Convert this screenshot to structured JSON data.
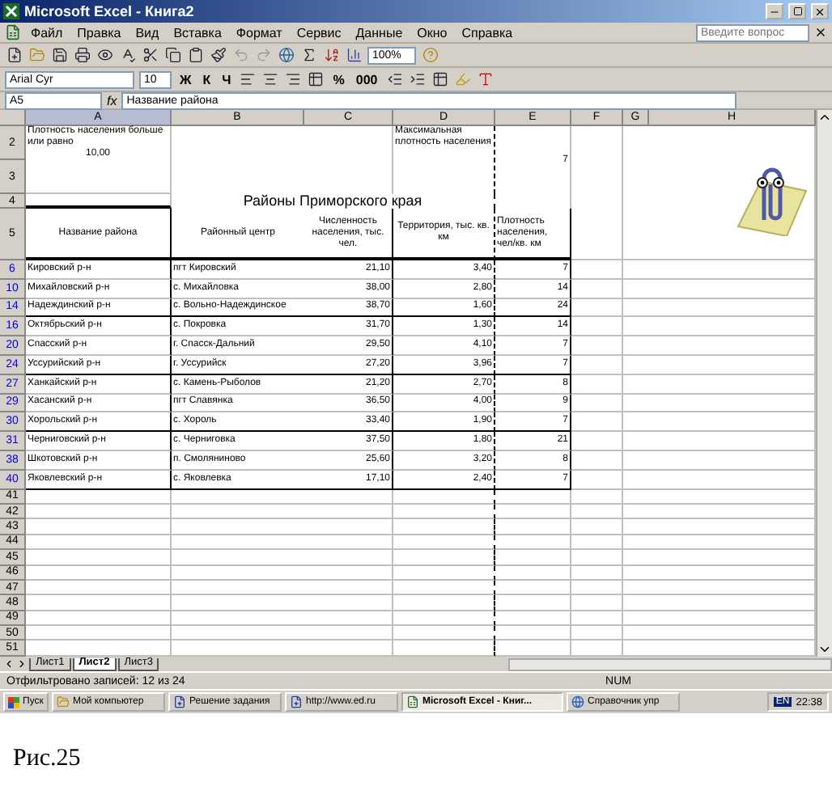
{
  "window": {
    "title": "Microsoft Excel - Книга2"
  },
  "menu": [
    "Файл",
    "Правка",
    "Вид",
    "Вставка",
    "Формат",
    "Сервис",
    "Данные",
    "Окно",
    "Справка"
  ],
  "help": {
    "placeholder": "Введите вопрос"
  },
  "standard_toolbar": {
    "zoom": "100%"
  },
  "format_toolbar": {
    "font": "Arial Cyr",
    "size": "10",
    "text_buttons": [
      {
        "label": "Ж",
        "selected": false
      },
      {
        "label": "К",
        "selected": false
      },
      {
        "label": "Ч",
        "selected": false
      }
    ],
    "number_buttons": [
      "%",
      "000"
    ]
  },
  "formula_bar": {
    "name_box": "A5",
    "fx_label": "fx",
    "formula": "Название района"
  },
  "columns": [
    {
      "label": "A",
      "selected": true
    },
    {
      "label": "B",
      "selected": false
    },
    {
      "label": "C",
      "selected": false
    },
    {
      "label": "D",
      "selected": false
    },
    {
      "label": "E",
      "selected": false
    },
    {
      "label": "F",
      "selected": false
    },
    {
      "label": "G",
      "selected": false
    },
    {
      "label": "H",
      "selected": false
    }
  ],
  "top_rows": {
    "row_labels": [
      "2",
      "3"
    ],
    "condition": "Плотность населения больше или равно",
    "threshold": "10,00",
    "max_label": "Максимальная плотность населения",
    "max_value": "7"
  },
  "title_row": {
    "row_label": "4",
    "title": "Районы Приморского края"
  },
  "header_row": {
    "row_label": "5",
    "cells": [
      "Название района",
      "Районный центр",
      "Численность населения, тыс. чел.",
      "Территория, тыс. кв. км",
      "Плотность населения, чел/кв. км"
    ]
  },
  "data_rows": [
    {
      "row_label": "6",
      "filtered": true,
      "cells": [
        "Кировский р-н",
        "пгт Кировский",
        "21,10",
        "3,40",
        "7"
      ]
    },
    {
      "row_label": "10",
      "filtered": true,
      "cells": [
        "Михайловский р-н",
        "с. Михайловка",
        "38,00",
        "2,80",
        "14"
      ]
    },
    {
      "row_label": "14",
      "filtered": true,
      "cells": [
        "Надеждинский р-н",
        "с. Вольно-Надеждинское",
        "38,70",
        "1,60",
        "24"
      ]
    },
    {
      "row_label": "16",
      "filtered": true,
      "cells": [
        "Октябрьский р-н",
        "с. Покровка",
        "31,70",
        "1,30",
        "14"
      ]
    },
    {
      "row_label": "20",
      "filtered": true,
      "cells": [
        "Спасский р-н",
        "г. Спасск-Дальний",
        "29,50",
        "4,10",
        "7"
      ]
    },
    {
      "row_label": "24",
      "filtered": true,
      "cells": [
        "Уссурийский р-н",
        "г. Уссурийск",
        "27,20",
        "3,96",
        "7"
      ]
    },
    {
      "row_label": "27",
      "filtered": true,
      "cells": [
        "Ханкайский р-н",
        "с. Камень-Рыболов",
        "21,20",
        "2,70",
        "8"
      ]
    },
    {
      "row_label": "29",
      "filtered": true,
      "cells": [
        "Хасанский р-н",
        "пгт Славянка",
        "36,50",
        "4,00",
        "9"
      ]
    },
    {
      "row_label": "30",
      "filtered": true,
      "cells": [
        "Хорольский р-н",
        "с. Хороль",
        "33,40",
        "1,90",
        "7"
      ]
    },
    {
      "row_label": "31",
      "filtered": true,
      "cells": [
        "Черниговский р-н",
        "с. Черниговка",
        "37,50",
        "1,80",
        "21"
      ]
    },
    {
      "row_label": "38",
      "filtered": true,
      "cells": [
        "Шкотовский р-н",
        "п. Смоляниново",
        "25,60",
        "3,20",
        "8"
      ]
    },
    {
      "row_label": "40",
      "filtered": true,
      "cells": [
        "Яковлевский р-н",
        "с. Яковлевка",
        "17,10",
        "2,40",
        "7"
      ]
    }
  ],
  "blank_rows": [
    {
      "row_label": "41",
      "filtered": false
    },
    {
      "row_label": "42",
      "filtered": false
    },
    {
      "row_label": "43",
      "filtered": false
    },
    {
      "row_label": "44",
      "filtered": false
    },
    {
      "row_label": "45",
      "filtered": false
    },
    {
      "row_label": "46",
      "filtered": false
    },
    {
      "row_label": "47",
      "filtered": false
    },
    {
      "row_label": "48",
      "filtered": false
    },
    {
      "row_label": "49",
      "filtered": false
    },
    {
      "row_label": "50",
      "filtered": false
    },
    {
      "row_label": "51",
      "filtered": false
    }
  ],
  "sheet_tabs": [
    {
      "label": "Лист1",
      "selected": false
    },
    {
      "label": "Лист2",
      "selected": true
    },
    {
      "label": "Лист3",
      "selected": false
    }
  ],
  "status_bar": {
    "text": "Отфильтровано записей: 12 из 24",
    "indicator": "NUM"
  },
  "taskbar": {
    "start": "Пуск",
    "items": [
      {
        "label": "Мой компьютер",
        "kind": "folder",
        "selected": false
      },
      {
        "label": "Решение задания",
        "kind": "doc",
        "selected": false
      },
      {
        "label": "http://www.ed.ru",
        "kind": "doc",
        "selected": false
      },
      {
        "label": "Microsoft Excel - Книг...",
        "kind": "excel",
        "selected": true
      },
      {
        "label": "Справочник упр",
        "kind": "web",
        "selected": false
      }
    ],
    "lang": "EN",
    "clock": "22:38"
  },
  "caption": "Рис.25"
}
